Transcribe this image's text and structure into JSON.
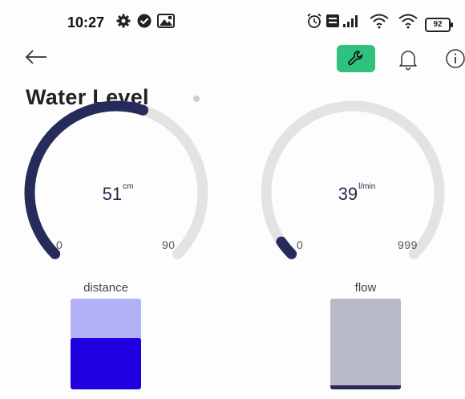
{
  "status_bar": {
    "time": "10:27",
    "battery": "92",
    "left_icons": [
      "gear-icon",
      "check-circle-icon",
      "image-icon"
    ],
    "right_icons": [
      "alarm-icon",
      "volte-icon",
      "signal-icon",
      "wifi-icon",
      "wifi-icon"
    ]
  },
  "toolbar": {
    "back_icon": "back-arrow-icon",
    "actions": [
      "wrench-icon",
      "bell-icon",
      "info-icon"
    ],
    "accent": "#2ec27e"
  },
  "page": {
    "title": "Water Level"
  },
  "gauges": [
    {
      "value": "51",
      "unit": "cm",
      "min": "0",
      "max": "90",
      "fraction": 0.567
    },
    {
      "value": "39",
      "unit": "l/min",
      "min": "0",
      "max": "999",
      "fraction": 0.039
    }
  ],
  "bars": [
    {
      "label": "distance",
      "fill_fraction": 0.57,
      "fill_color": "#1e00e0",
      "bg_color": "#b3b1f5"
    },
    {
      "label": "flow",
      "fill_fraction": 0.04,
      "fill_color": "#2a2a52",
      "bg_color": "#b9bac9"
    }
  ],
  "colors": {
    "gauge_track": "#e3e3e3",
    "gauge_fill": "#272b5c"
  }
}
